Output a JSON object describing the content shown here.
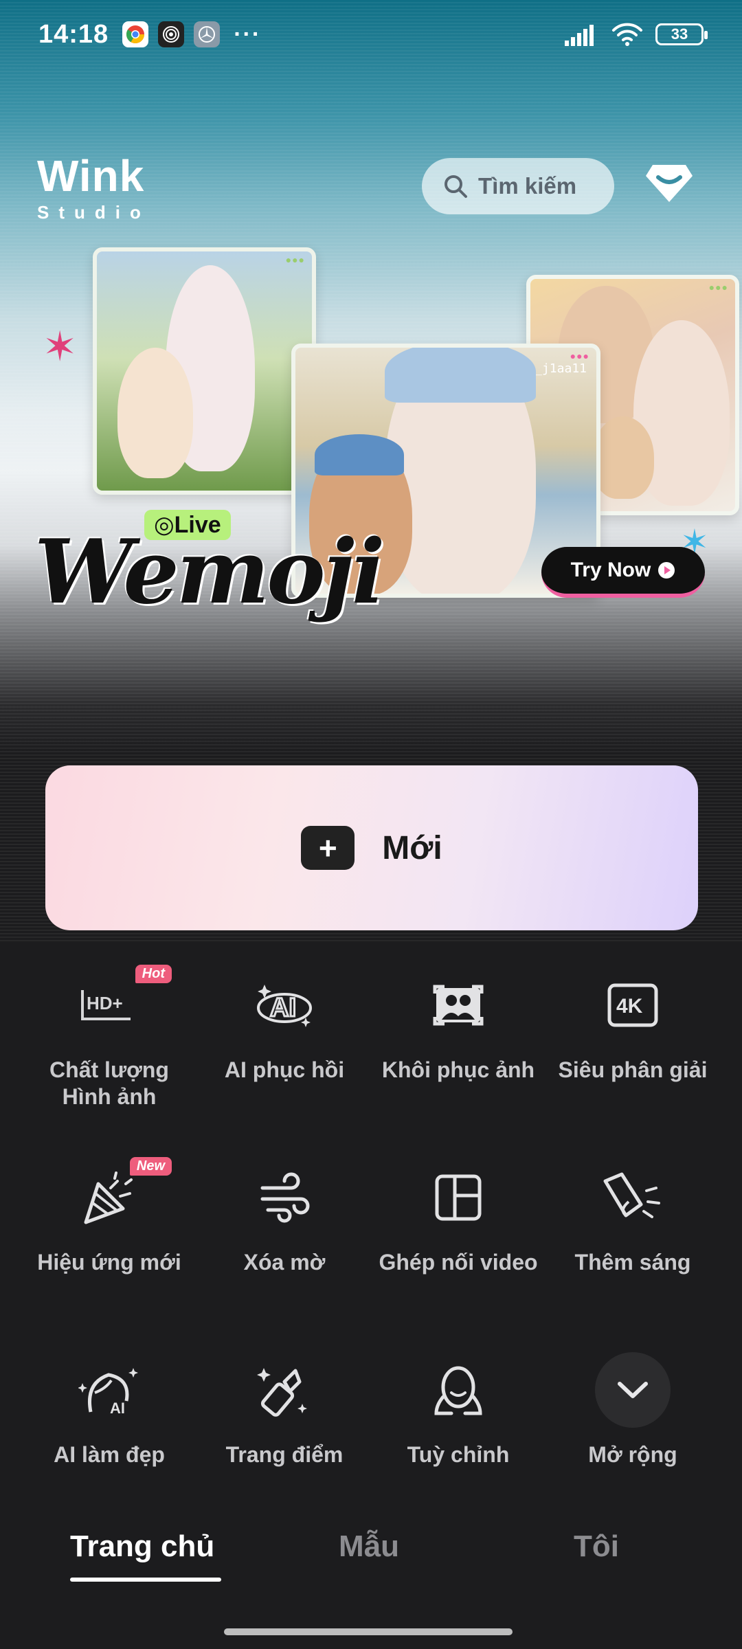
{
  "status_bar": {
    "time": "14:18",
    "battery": "33",
    "app_icons": [
      "chrome-icon",
      "spiral-app-icon",
      "mercedes-app-icon"
    ],
    "more": "···"
  },
  "header": {
    "logo_top": "Wink",
    "logo_bottom": "Studio",
    "search_placeholder": "Tìm kiếm"
  },
  "banner": {
    "live_label": "◎Live",
    "title": "Wemoji",
    "handle": "@_j1aa11",
    "cta": "Try Now"
  },
  "new_card": {
    "label": "Mới"
  },
  "tools": [
    {
      "label": "Chất lượng Hình ảnh",
      "badge": "Hot",
      "icon": "hd-plus-icon"
    },
    {
      "label": "AI phục hồi",
      "icon": "ai-restore-icon"
    },
    {
      "label": "Khôi phục ảnh",
      "icon": "photo-restore-icon"
    },
    {
      "label": "Siêu phân giải",
      "icon": "4k-icon"
    },
    {
      "label": "Hiệu ứng mới",
      "badge": "New",
      "icon": "party-popper-icon"
    },
    {
      "label": "Xóa mờ",
      "icon": "wind-icon"
    },
    {
      "label": "Ghép nối video",
      "icon": "collage-icon"
    },
    {
      "label": "Thêm sáng",
      "icon": "light-icon"
    },
    {
      "label": "AI làm đẹp",
      "icon": "ai-beauty-icon"
    },
    {
      "label": "Trang điểm",
      "icon": "makeup-icon"
    },
    {
      "label": "Tuỳ chỉnh",
      "icon": "face-icon"
    },
    {
      "label": "Mở rộng",
      "icon": "chevron-down-icon"
    }
  ],
  "bottom_nav": {
    "items": [
      "Trang chủ",
      "Mẫu",
      "Tôi"
    ],
    "active": "Trang chủ"
  },
  "colors": {
    "badge": "#ee5d7d",
    "live_tag": "#b7f07c",
    "background_dark": "#1c1c1e"
  }
}
